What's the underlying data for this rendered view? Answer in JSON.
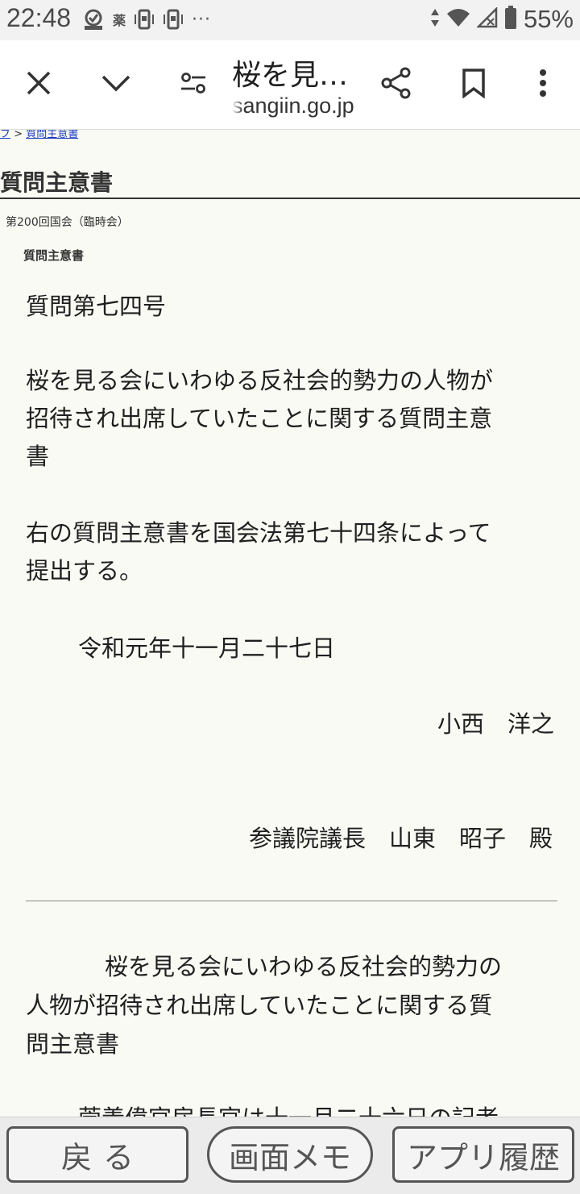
{
  "status_bar": {
    "time": "22:48",
    "kanji_badge": "薬",
    "more_indicator": "···",
    "battery": "55%"
  },
  "toolbar": {
    "page_title": "桜を見…",
    "url": "sangiin.go.jp"
  },
  "page": {
    "breadcrumb_prev": "ブ",
    "breadcrumb_sep": ">",
    "breadcrumb_current": "質問主意書",
    "heading": "質問主意書",
    "session": "第200回国会（臨時会）",
    "doc_type": "質問主意書",
    "question_number": "質問第七四号",
    "title_line1": "桜を見る会にいわゆる反社会的勢力の人物が",
    "title_line2": "招待され出席していたことに関する質問主意",
    "title_line3": "書",
    "submission_line1": "右の質問主意書を国会法第七十四条によって",
    "submission_line2": "提出する。",
    "date": "令和元年十一月二十七日",
    "submitter": "小西　洋之",
    "addressee": "参議院議長　山東　昭子　殿",
    "repeat_title_line1": "桜を見る会にいわゆる反社会的勢力の",
    "repeat_title_line2": "人物が招待され出席していたことに関する質",
    "repeat_title_line3": "問主意書",
    "cutoff_line": "菅義偉官房長官は十一月二十六日の記者"
  },
  "bottom_bar": {
    "back": "戻る",
    "screen_memo": "画面メモ",
    "app_history": "アプリ履歴"
  }
}
